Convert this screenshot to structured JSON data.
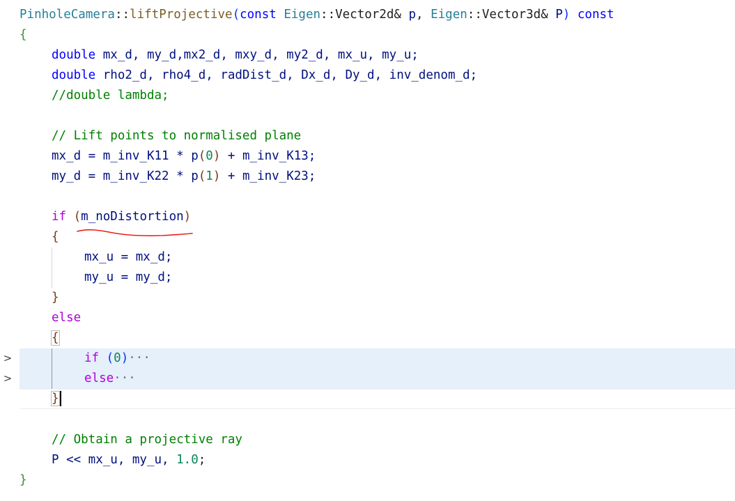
{
  "editor": {
    "lines": {
      "l1_name": "PinholeCamera",
      "l1_scope": "::",
      "l1_fn": "liftProjective",
      "l1_open": "(",
      "l1_const1": "const",
      "l1_type1": "Eigen",
      "l1_scope2": "::",
      "l1_type1b": "Vector2d",
      "l1_amp1": "& ",
      "l1_p": "p",
      "l1_comma": ", ",
      "l1_type2": "Eigen",
      "l1_scope3": "::",
      "l1_type2b": "Vector3d",
      "l1_amp2": "& ",
      "l1_P": "P",
      "l1_close": ")",
      "l1_const2": "const",
      "l2_brace": "{",
      "l3_kw": "double",
      "l3_vars": " mx_d, my_d,mx2_d, mxy_d, my2_d, mx_u, my_u;",
      "l4_kw": "double",
      "l4_vars": " rho2_d, rho4_d, radDist_d, Dx_d, Dy_d, inv_denom_d;",
      "l5_comment": "//double lambda;",
      "l7_comment": "// Lift points to normalised plane",
      "l8_lhs": "mx_d = m_inv_K11 * ",
      "l8_p": "p",
      "l8_open": "(",
      "l8_num": "0",
      "l8_close": ")",
      "l8_rhs": " + m_inv_K13;",
      "l9_lhs": "my_d = m_inv_K22 * ",
      "l9_p": "p",
      "l9_open": "(",
      "l9_num": "1",
      "l9_close": ")",
      "l9_rhs": " + m_inv_K23;",
      "l11_if": "if",
      "l11_open": " (",
      "l11_var": "m_noDistortion",
      "l11_close": ")",
      "l12_brace": "{",
      "l13_code": "mx_u = mx_d;",
      "l14_code": "my_u = my_d;",
      "l15_brace": "}",
      "l16_else": "else",
      "l17_brace": "{",
      "l18_if": "if",
      "l18_open": " (",
      "l18_num": "0",
      "l18_close": ")",
      "l18_ellipsis": "···",
      "l19_else": "else",
      "l19_ellipsis": "···",
      "l20_brace": "}",
      "l22_comment": "// Obtain a projective ray",
      "l23_lhs": "P << mx_u, my_u, ",
      "l23_num": "1.0",
      "l23_end": ";",
      "l24_brace": "}"
    },
    "fold_markers": [
      ">",
      ">"
    ],
    "annotation_color": "#e8201a",
    "highlight_color": "#e5f0fb"
  }
}
